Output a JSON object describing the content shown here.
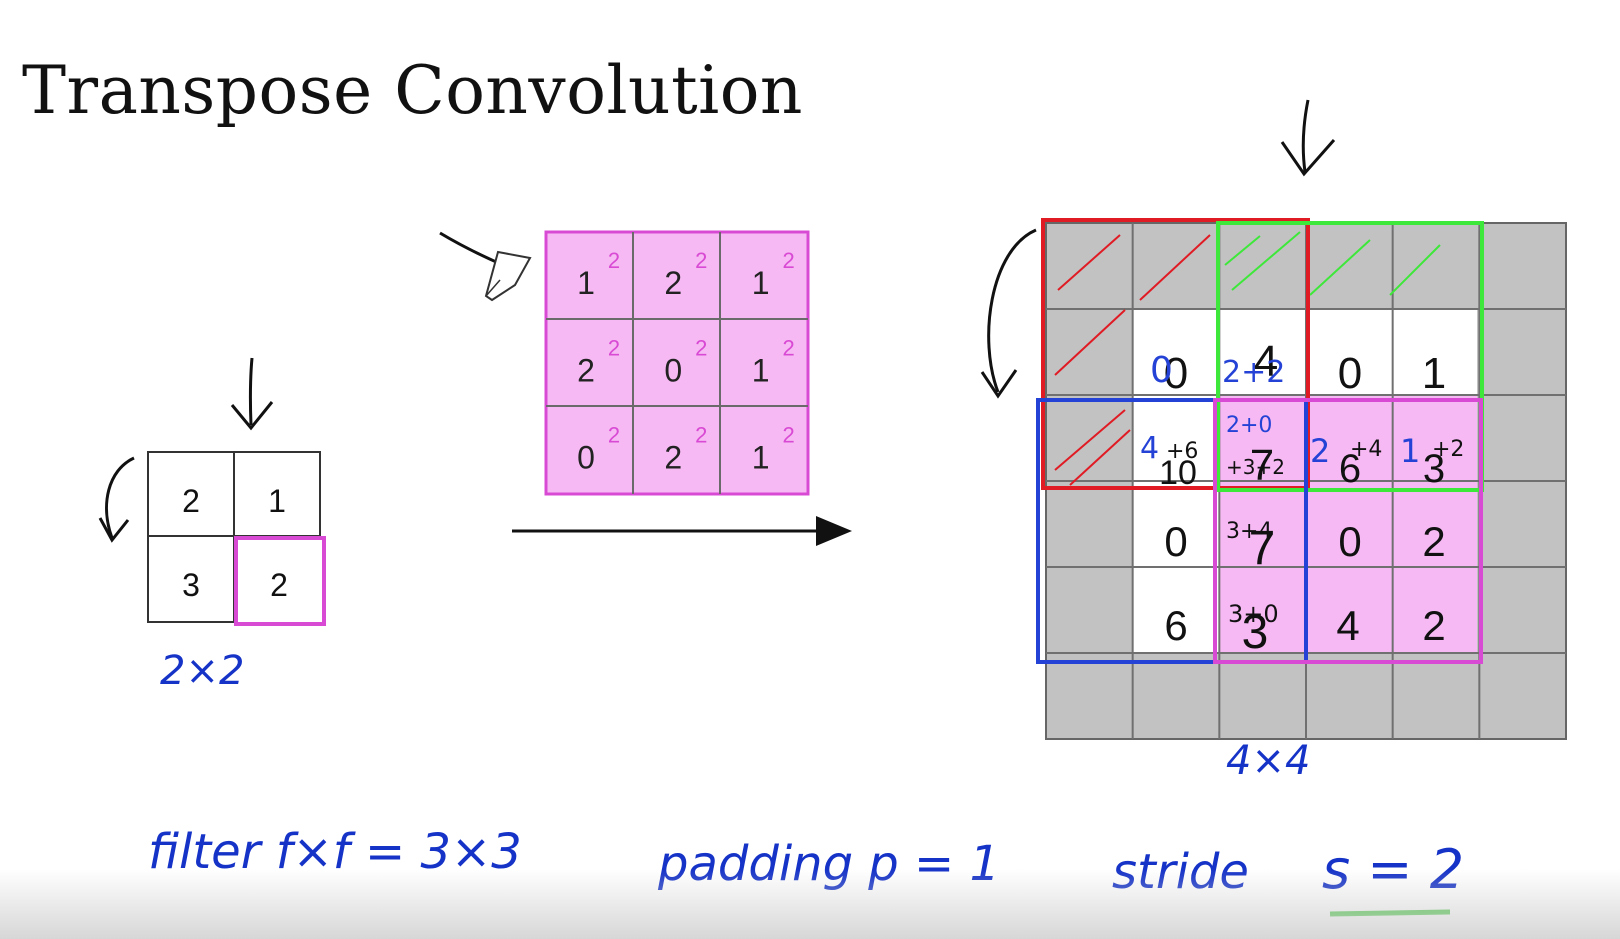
{
  "title": "Transpose Convolution",
  "input": {
    "values": [
      [
        2,
        1
      ],
      [
        3,
        2
      ]
    ],
    "size_label": "2×2",
    "highlight_cell": [
      1,
      1
    ]
  },
  "filter": {
    "values": [
      [
        1,
        2,
        1
      ],
      [
        2,
        0,
        1
      ],
      [
        0,
        2,
        1
      ]
    ],
    "scaled_values": [
      [
        2,
        2,
        2
      ],
      [
        2,
        2,
        2
      ],
      [
        2,
        2,
        2
      ]
    ]
  },
  "output": {
    "size_label": "4×4",
    "cells": [
      [
        "0",
        "4",
        "0",
        "1"
      ],
      [
        "10",
        "7",
        "6",
        "3"
      ],
      [
        "0",
        "7",
        "0",
        "2"
      ],
      [
        "6",
        "3",
        "4",
        "2"
      ]
    ],
    "annotations": {
      "r0c0": "0",
      "r0c1": "2+2",
      "r1c0_a": "4",
      "r1c0_b": "+6",
      "r1c1_a": "2+0",
      "r1c1_b": "+3+2",
      "r1c2_a": "2",
      "r1c2_b": "+4",
      "r1c3_a": "1",
      "r1c3_b": "+2",
      "r2c1": "3+4",
      "r3c1": "3+0"
    }
  },
  "params": {
    "filter": "filter  f×f = 3×3",
    "padding": "padding  p = 1",
    "stride_prefix": "stride",
    "stride_value": "s = 2"
  },
  "colors": {
    "pink": "#f6b9f3",
    "magenta": "#d94ad4",
    "red": "#e01b24",
    "green": "#3ee83a",
    "blue": "#2442d6",
    "gray": "#c2c2c2"
  }
}
